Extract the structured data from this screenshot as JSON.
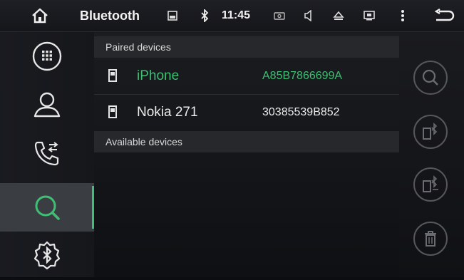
{
  "topbar": {
    "title": "Bluetooth",
    "time": "11:45",
    "icons": [
      "home-icon",
      "screen-icon",
      "bluetooth-icon",
      "camera-icon",
      "volume-icon",
      "eject-icon",
      "display-icon",
      "more-icon",
      "back-icon"
    ]
  },
  "sidebar": {
    "items": [
      {
        "icon": "dialpad-icon"
      },
      {
        "icon": "contacts-icon"
      },
      {
        "icon": "call-log-icon"
      },
      {
        "icon": "search-devices-icon",
        "active": true
      },
      {
        "icon": "bluetooth-settings-icon"
      }
    ]
  },
  "paired": {
    "header": "Paired devices",
    "devices": [
      {
        "name": "iPhone",
        "address": "A85B7866699A",
        "connected": true
      },
      {
        "name": "Nokia 271",
        "address": "30385539B852",
        "connected": false
      }
    ]
  },
  "available": {
    "header": "Available devices"
  },
  "actions": [
    "search-icon",
    "connect-icon",
    "disconnect-icon",
    "delete-icon"
  ],
  "colors": {
    "accent": "#3fbf74",
    "background": "#0c0d10"
  }
}
